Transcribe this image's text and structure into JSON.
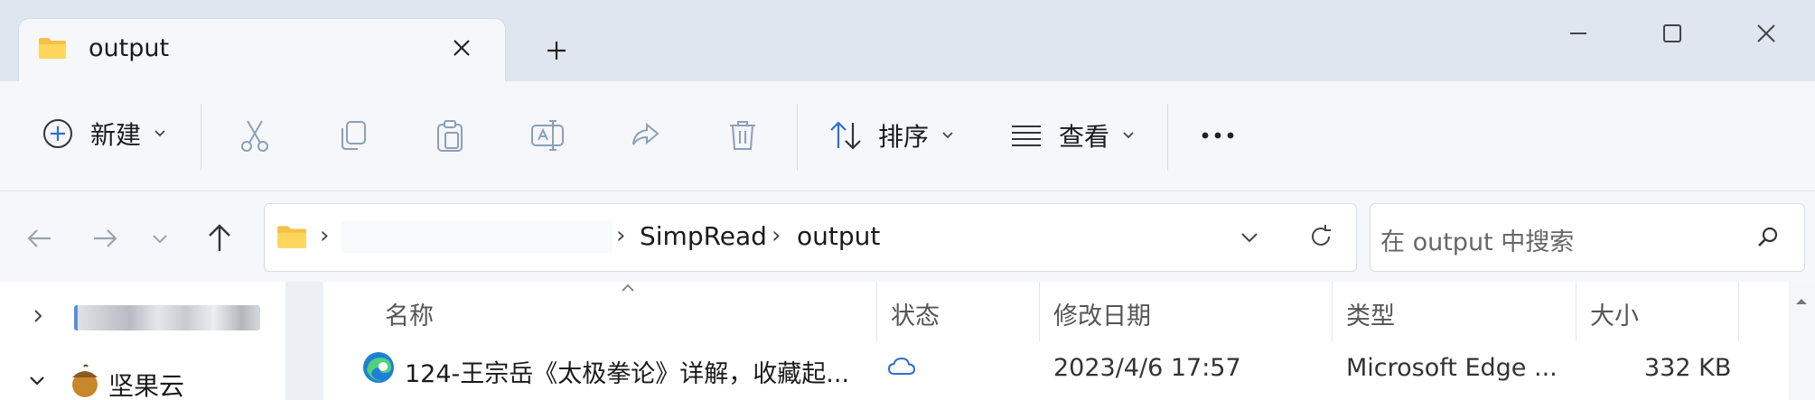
{
  "tab": {
    "title": "output"
  },
  "toolbar": {
    "new_label": "新建",
    "sort_label": "排序",
    "view_label": "查看"
  },
  "address": {
    "crumbs": [
      "SimpRead",
      "output"
    ],
    "search_placeholder": "在 output 中搜索"
  },
  "nav": {
    "items": [
      {
        "label": ""
      },
      {
        "label": "坚果云"
      }
    ]
  },
  "columns": {
    "name": "名称",
    "status": "状态",
    "modified": "修改日期",
    "type": "类型",
    "size": "大小"
  },
  "files": [
    {
      "name": "124-王宗岳《太极拳论》详解，收藏起...",
      "modified": "2023/4/6 17:57",
      "type": "Microsoft Edge ...",
      "size": "332 KB"
    }
  ]
}
